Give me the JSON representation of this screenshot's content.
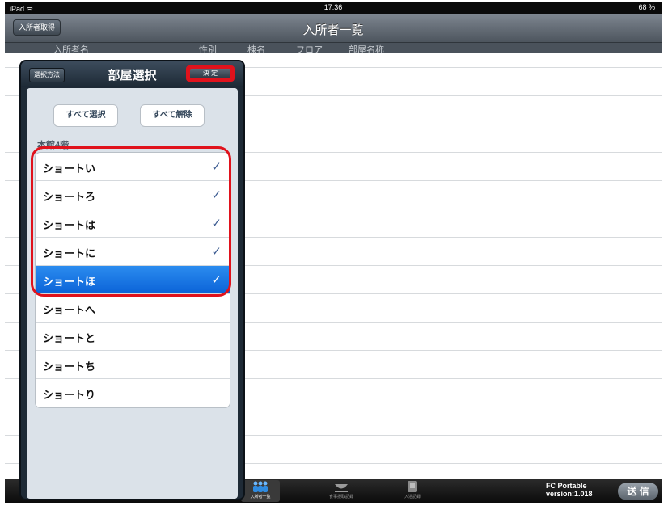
{
  "status_bar": {
    "device": "iPad ᯤ",
    "time": "17:36",
    "battery": "68 %"
  },
  "nav": {
    "title": "入所者一覧",
    "left_button": "入所者取得"
  },
  "column_headers": [
    "入所者名",
    "性別",
    "棟名",
    "フロア",
    "部屋名称"
  ],
  "popover": {
    "title": "部屋選択",
    "method_button": "選択方法",
    "done_button": "決 定",
    "select_all": "すべて選択",
    "deselect_all": "すべて解除",
    "section": "本館4階",
    "rooms": [
      {
        "label": "ショートい",
        "check": "✓"
      },
      {
        "label": "ショートろ",
        "check": "✓"
      },
      {
        "label": "ショートは",
        "check": "✓"
      },
      {
        "label": "ショートに",
        "check": "✓"
      },
      {
        "label": "ショートほ",
        "check": "✓"
      },
      {
        "label": "ショートへ",
        "check": ""
      },
      {
        "label": "ショートと",
        "check": ""
      },
      {
        "label": "ショートち",
        "check": ""
      },
      {
        "label": "ショートり",
        "check": ""
      }
    ]
  },
  "tabs": [
    {
      "label": "入所者一覧",
      "icon": "people-icon"
    },
    {
      "label": "食事摂取記録",
      "icon": "bowl-icon"
    },
    {
      "label": "入浴記録",
      "icon": "bath-icon"
    }
  ],
  "footer": {
    "app_name": "FC Portable",
    "version": "version:1.018",
    "send": "送 信"
  },
  "colors": {
    "selection_blue": "#1a78e6",
    "highlight_red": "#e0121c",
    "check_blue": "#3a5a90"
  }
}
